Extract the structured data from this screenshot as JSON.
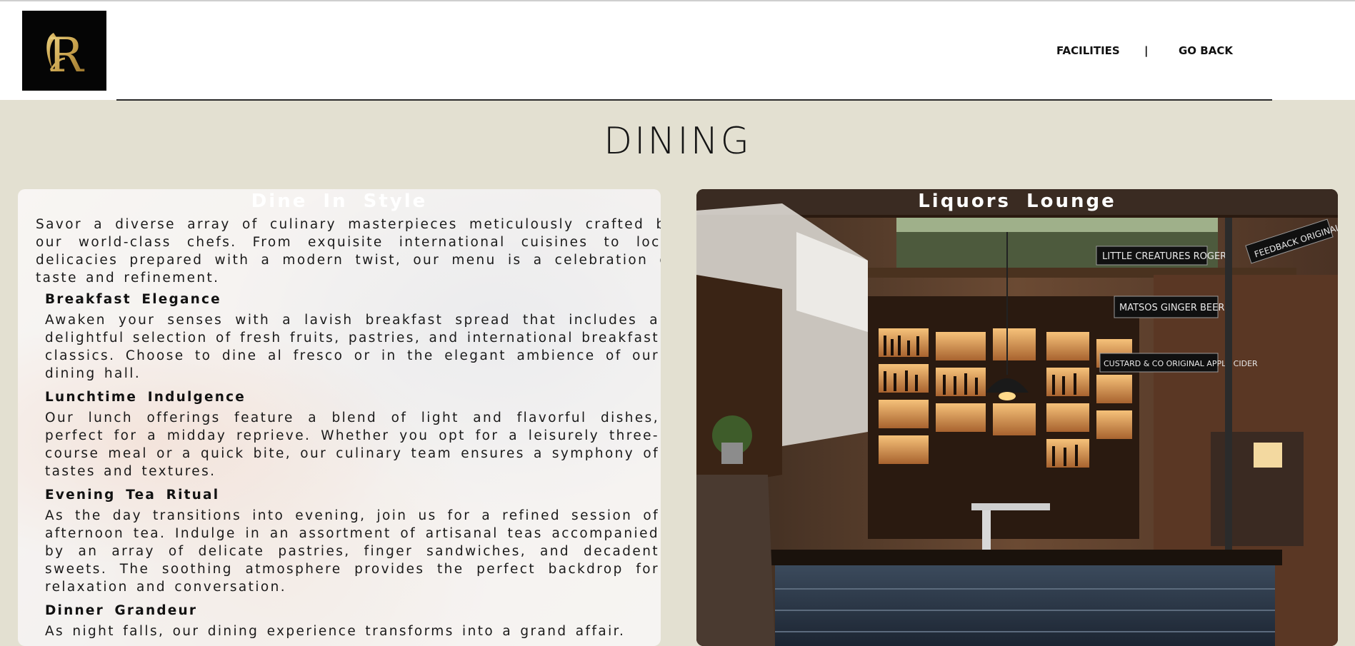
{
  "header": {
    "logo_letter": "R",
    "nav": {
      "facilities": "FACILITIES",
      "separator": "|",
      "go_back": "GO BACK"
    }
  },
  "page": {
    "title": "DINING"
  },
  "dine_in_style": {
    "title": "Dine  In  Style",
    "intro": "Savor a diverse array of culinary masterpieces meticulously crafted by our world-class chefs. From exquisite international cuisines to local delicacies prepared with a modern twist, our menu is a celebration of taste and refinement.",
    "sections": [
      {
        "heading": "Breakfast  Elegance",
        "text": "Awaken your senses with a lavish breakfast spread that includes a delightful selection of fresh fruits, pastries, and international breakfast classics. Choose to dine al fresco or in the elegant ambience of our dining hall."
      },
      {
        "heading": "Lunchtime  Indulgence",
        "text": "Our lunch offerings feature a blend of light and flavorful dishes, perfect for a midday reprieve. Whether you opt for a leisurely three-course meal or a quick bite, our culinary team ensures a symphony of tastes and textures."
      },
      {
        "heading": "Evening  Tea  Ritual",
        "text": "As the day transitions into evening, join us for a refined session of afternoon tea. Indulge in an assortment of artisanal teas accompanied by an array of delicate pastries, finger sandwiches, and decadent sweets. The soothing atmosphere provides the perfect backdrop for relaxation and conversation."
      },
      {
        "heading": "Dinner  Grandeur",
        "text": "As night falls, our dining experience transforms into a grand affair."
      }
    ]
  },
  "liquors_lounge": {
    "title": "Liquors  Lounge",
    "signs": [
      "LITTLE CREATURES ROGERS",
      "MATSOS GINGER BEER",
      "CUSTARD & CO ORIGINAL APPLE CIDER",
      "FEEDBACK ORIGINAL"
    ]
  }
}
